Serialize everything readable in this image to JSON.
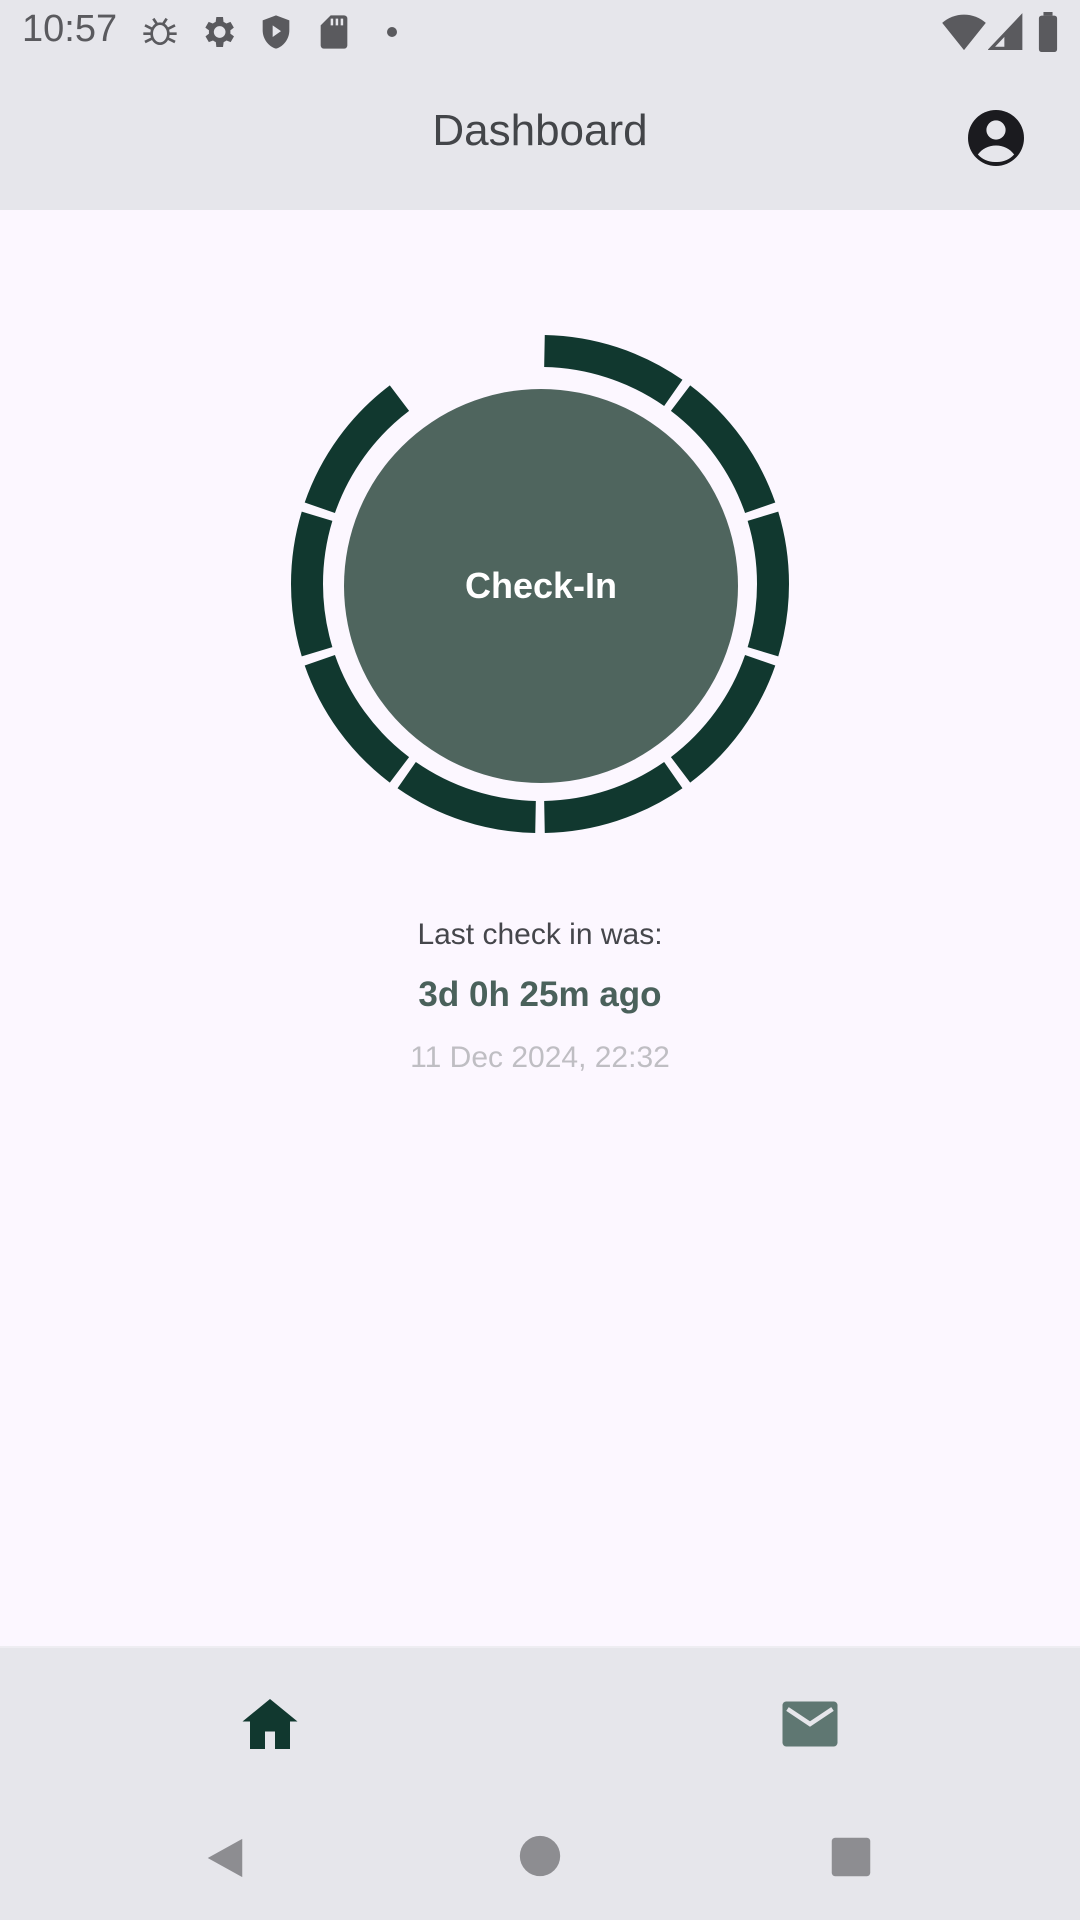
{
  "status_bar": {
    "time": "10:57",
    "icons": [
      "bug-icon",
      "settings-gear-icon",
      "shield-play-icon",
      "sd-card-icon",
      "dot-icon",
      "wifi-icon",
      "cell-signal-icon",
      "battery-icon"
    ]
  },
  "header": {
    "title": "Dashboard",
    "account_icon": "account-circle-icon"
  },
  "checkin": {
    "button_label": "Check-In",
    "progress_segments_filled": 9,
    "progress_segments_total": 10,
    "ring_color": "#11382F",
    "button_color": "#4F655E"
  },
  "info": {
    "label": "Last check in was:",
    "elapsed": "3d 0h 25m ago",
    "timestamp": "11 Dec 2024, 22:32"
  },
  "bottom_nav": {
    "items": [
      {
        "icon": "home-icon",
        "selected": true
      },
      {
        "icon": "mail-icon",
        "selected": false
      }
    ]
  },
  "system_nav": {
    "items": [
      "back-icon",
      "home-circle-icon",
      "recents-icon"
    ]
  },
  "colors": {
    "background": "#FCF7FF",
    "bar_background": "#E6E6EB",
    "accent_dark": "#11382F",
    "accent_text": "#4A615B"
  }
}
